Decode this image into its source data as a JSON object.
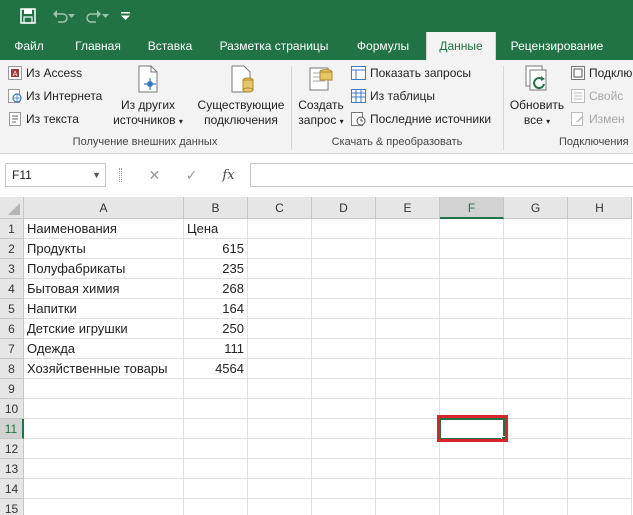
{
  "tabs": [
    "Файл",
    "Главная",
    "Вставка",
    "Разметка страницы",
    "Формулы",
    "Данные",
    "Рецензирование"
  ],
  "active_tab": "Данные",
  "ribbon": {
    "get_external": {
      "from_access": "Из Access",
      "from_web": "Из Интернета",
      "from_text": "Из текста",
      "from_other_1": "Из других",
      "from_other_2": "источников",
      "existing_1": "Существующие",
      "existing_2": "подключения",
      "label": "Получение внешних данных"
    },
    "get_transform": {
      "new_query_1": "Создать",
      "new_query_2": "запрос",
      "show_queries": "Показать запросы",
      "from_table": "Из таблицы",
      "recent_sources": "Последние источники",
      "label": "Скачать & преобразовать"
    },
    "connections": {
      "refresh_1": "Обновить",
      "refresh_2": "все",
      "connections": "Подклю",
      "properties": "Свойс",
      "edit_links": "Измен",
      "label": "Подключения"
    }
  },
  "formula_bar": {
    "name_box": "F11",
    "fx": "fx",
    "formula": ""
  },
  "columns": [
    "A",
    "B",
    "C",
    "D",
    "E",
    "F",
    "G",
    "H"
  ],
  "rows": [
    "1",
    "2",
    "3",
    "4",
    "5",
    "6",
    "7",
    "8",
    "9",
    "10",
    "11",
    "12",
    "13",
    "14",
    "15"
  ],
  "selected_cell": "F11",
  "cells": {
    "A1": "Наименования",
    "B1": "Цена",
    "A2": "Продукты",
    "B2": "615",
    "A3": "Полуфабрикаты",
    "B3": "235",
    "A4": "Бытовая химия",
    "B4": "268",
    "A5": "Напитки",
    "B5": "164",
    "A6": "Детские игрушки",
    "B6": "250",
    "A7": "Одежда",
    "B7": "111",
    "A8": "Хозяйственные товары",
    "B8": "4564"
  },
  "colors": {
    "excel_green": "#217346",
    "highlight_red": "#d6262a"
  }
}
